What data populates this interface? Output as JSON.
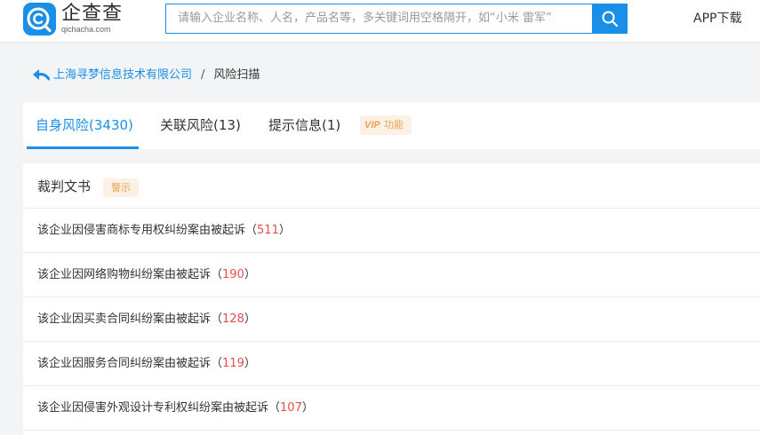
{
  "header": {
    "logo_name": "企查查",
    "logo_domain": "qichacha.com",
    "search_placeholder": "请输入企业名称、人名，产品名等，多关键词用空格隔开，如“小米 雷军”",
    "app_download": "APP下载"
  },
  "breadcrumb": {
    "company": "上海寻梦信息技术有限公司",
    "separator": "/",
    "current": "风险扫描"
  },
  "tabs": [
    {
      "label": "自身风险(3430)",
      "active": true
    },
    {
      "label": "关联风险(13)",
      "active": false
    },
    {
      "label": "提示信息(1)",
      "active": false
    }
  ],
  "vip_badge": {
    "vip": "VIP",
    "label": "功能"
  },
  "section": {
    "title": "裁判文书",
    "tag": "警示"
  },
  "risk_rows": [
    {
      "text": "该企业因侵害商标专用权纠纷案由被起诉",
      "count": "511"
    },
    {
      "text": "该企业因网络购物纠纷案由被起诉",
      "count": "190"
    },
    {
      "text": "该企业因买卖合同纠纷案由被起诉",
      "count": "128"
    },
    {
      "text": "该企业因服务合同纠纷案由被起诉",
      "count": "119"
    },
    {
      "text": "该企业因侵害外观设计专利权纠纷案由被起诉",
      "count": "107"
    }
  ],
  "symbols": {
    "open_paren": "（",
    "close_paren": "）"
  },
  "colors": {
    "brand_blue": "#1a8fe8",
    "count_red": "#e84d4d",
    "tag_orange": "#e7a258"
  }
}
